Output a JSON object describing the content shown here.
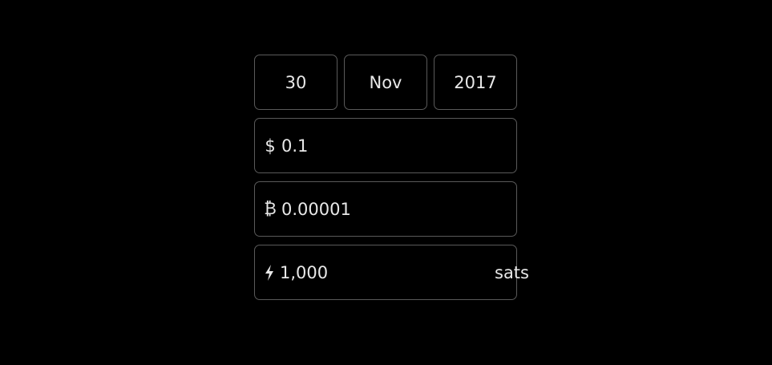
{
  "date": {
    "day": "30",
    "month": "Nov",
    "year": "2017"
  },
  "fields": {
    "usd": {
      "symbol": "$",
      "value": "0.1"
    },
    "btc": {
      "symbol": "₿",
      "value": "0.00001"
    },
    "sats": {
      "symbol_icon": "lightning-icon",
      "value": "1,000",
      "unit": "sats"
    }
  },
  "colors": {
    "background": "#000000",
    "border": "#5a5a5a",
    "text": "#e8e8e8"
  }
}
